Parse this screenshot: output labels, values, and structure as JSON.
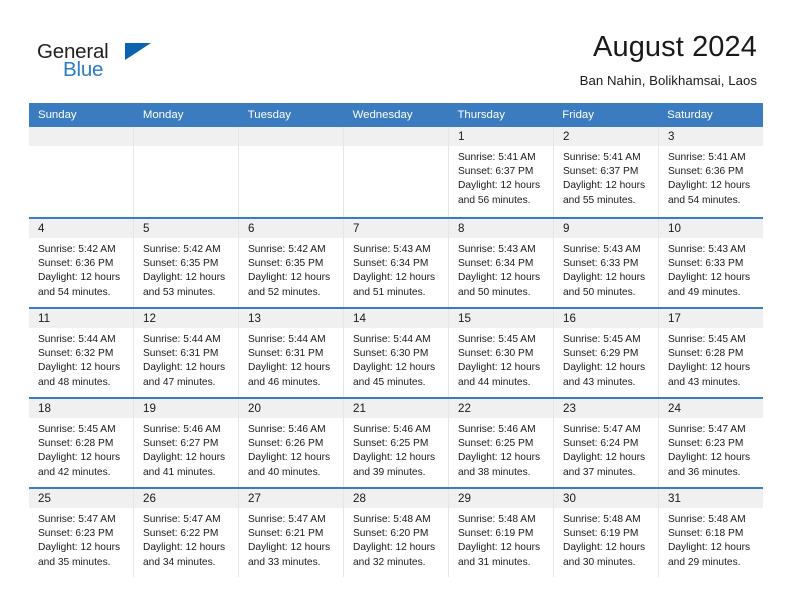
{
  "logo": {
    "word1": "General",
    "word2": "Blue",
    "flag_color": "#0b63ad"
  },
  "header": {
    "title": "August 2024",
    "subtitle": "Ban Nahin, Bolikhamsai, Laos"
  },
  "theme": {
    "header_band": "#3a7cbf",
    "daynum_band": "#f0f0f0",
    "cell_border": "#e6e6e6",
    "text": "#1a1a1a"
  },
  "weekdays": [
    "Sunday",
    "Monday",
    "Tuesday",
    "Wednesday",
    "Thursday",
    "Friday",
    "Saturday"
  ],
  "weeks": [
    [
      {
        "empty": true
      },
      {
        "empty": true
      },
      {
        "empty": true
      },
      {
        "empty": true
      },
      {
        "day": "1",
        "sunrise": "Sunrise: 5:41 AM",
        "sunset": "Sunset: 6:37 PM",
        "daylight1": "Daylight: 12 hours",
        "daylight2": "and 56 minutes."
      },
      {
        "day": "2",
        "sunrise": "Sunrise: 5:41 AM",
        "sunset": "Sunset: 6:37 PM",
        "daylight1": "Daylight: 12 hours",
        "daylight2": "and 55 minutes."
      },
      {
        "day": "3",
        "sunrise": "Sunrise: 5:41 AM",
        "sunset": "Sunset: 6:36 PM",
        "daylight1": "Daylight: 12 hours",
        "daylight2": "and 54 minutes."
      }
    ],
    [
      {
        "day": "4",
        "sunrise": "Sunrise: 5:42 AM",
        "sunset": "Sunset: 6:36 PM",
        "daylight1": "Daylight: 12 hours",
        "daylight2": "and 54 minutes."
      },
      {
        "day": "5",
        "sunrise": "Sunrise: 5:42 AM",
        "sunset": "Sunset: 6:35 PM",
        "daylight1": "Daylight: 12 hours",
        "daylight2": "and 53 minutes."
      },
      {
        "day": "6",
        "sunrise": "Sunrise: 5:42 AM",
        "sunset": "Sunset: 6:35 PM",
        "daylight1": "Daylight: 12 hours",
        "daylight2": "and 52 minutes."
      },
      {
        "day": "7",
        "sunrise": "Sunrise: 5:43 AM",
        "sunset": "Sunset: 6:34 PM",
        "daylight1": "Daylight: 12 hours",
        "daylight2": "and 51 minutes."
      },
      {
        "day": "8",
        "sunrise": "Sunrise: 5:43 AM",
        "sunset": "Sunset: 6:34 PM",
        "daylight1": "Daylight: 12 hours",
        "daylight2": "and 50 minutes."
      },
      {
        "day": "9",
        "sunrise": "Sunrise: 5:43 AM",
        "sunset": "Sunset: 6:33 PM",
        "daylight1": "Daylight: 12 hours",
        "daylight2": "and 50 minutes."
      },
      {
        "day": "10",
        "sunrise": "Sunrise: 5:43 AM",
        "sunset": "Sunset: 6:33 PM",
        "daylight1": "Daylight: 12 hours",
        "daylight2": "and 49 minutes."
      }
    ],
    [
      {
        "day": "11",
        "sunrise": "Sunrise: 5:44 AM",
        "sunset": "Sunset: 6:32 PM",
        "daylight1": "Daylight: 12 hours",
        "daylight2": "and 48 minutes."
      },
      {
        "day": "12",
        "sunrise": "Sunrise: 5:44 AM",
        "sunset": "Sunset: 6:31 PM",
        "daylight1": "Daylight: 12 hours",
        "daylight2": "and 47 minutes."
      },
      {
        "day": "13",
        "sunrise": "Sunrise: 5:44 AM",
        "sunset": "Sunset: 6:31 PM",
        "daylight1": "Daylight: 12 hours",
        "daylight2": "and 46 minutes."
      },
      {
        "day": "14",
        "sunrise": "Sunrise: 5:44 AM",
        "sunset": "Sunset: 6:30 PM",
        "daylight1": "Daylight: 12 hours",
        "daylight2": "and 45 minutes."
      },
      {
        "day": "15",
        "sunrise": "Sunrise: 5:45 AM",
        "sunset": "Sunset: 6:30 PM",
        "daylight1": "Daylight: 12 hours",
        "daylight2": "and 44 minutes."
      },
      {
        "day": "16",
        "sunrise": "Sunrise: 5:45 AM",
        "sunset": "Sunset: 6:29 PM",
        "daylight1": "Daylight: 12 hours",
        "daylight2": "and 43 minutes."
      },
      {
        "day": "17",
        "sunrise": "Sunrise: 5:45 AM",
        "sunset": "Sunset: 6:28 PM",
        "daylight1": "Daylight: 12 hours",
        "daylight2": "and 43 minutes."
      }
    ],
    [
      {
        "day": "18",
        "sunrise": "Sunrise: 5:45 AM",
        "sunset": "Sunset: 6:28 PM",
        "daylight1": "Daylight: 12 hours",
        "daylight2": "and 42 minutes."
      },
      {
        "day": "19",
        "sunrise": "Sunrise: 5:46 AM",
        "sunset": "Sunset: 6:27 PM",
        "daylight1": "Daylight: 12 hours",
        "daylight2": "and 41 minutes."
      },
      {
        "day": "20",
        "sunrise": "Sunrise: 5:46 AM",
        "sunset": "Sunset: 6:26 PM",
        "daylight1": "Daylight: 12 hours",
        "daylight2": "and 40 minutes."
      },
      {
        "day": "21",
        "sunrise": "Sunrise: 5:46 AM",
        "sunset": "Sunset: 6:25 PM",
        "daylight1": "Daylight: 12 hours",
        "daylight2": "and 39 minutes."
      },
      {
        "day": "22",
        "sunrise": "Sunrise: 5:46 AM",
        "sunset": "Sunset: 6:25 PM",
        "daylight1": "Daylight: 12 hours",
        "daylight2": "and 38 minutes."
      },
      {
        "day": "23",
        "sunrise": "Sunrise: 5:47 AM",
        "sunset": "Sunset: 6:24 PM",
        "daylight1": "Daylight: 12 hours",
        "daylight2": "and 37 minutes."
      },
      {
        "day": "24",
        "sunrise": "Sunrise: 5:47 AM",
        "sunset": "Sunset: 6:23 PM",
        "daylight1": "Daylight: 12 hours",
        "daylight2": "and 36 minutes."
      }
    ],
    [
      {
        "day": "25",
        "sunrise": "Sunrise: 5:47 AM",
        "sunset": "Sunset: 6:23 PM",
        "daylight1": "Daylight: 12 hours",
        "daylight2": "and 35 minutes."
      },
      {
        "day": "26",
        "sunrise": "Sunrise: 5:47 AM",
        "sunset": "Sunset: 6:22 PM",
        "daylight1": "Daylight: 12 hours",
        "daylight2": "and 34 minutes."
      },
      {
        "day": "27",
        "sunrise": "Sunrise: 5:47 AM",
        "sunset": "Sunset: 6:21 PM",
        "daylight1": "Daylight: 12 hours",
        "daylight2": "and 33 minutes."
      },
      {
        "day": "28",
        "sunrise": "Sunrise: 5:48 AM",
        "sunset": "Sunset: 6:20 PM",
        "daylight1": "Daylight: 12 hours",
        "daylight2": "and 32 minutes."
      },
      {
        "day": "29",
        "sunrise": "Sunrise: 5:48 AM",
        "sunset": "Sunset: 6:19 PM",
        "daylight1": "Daylight: 12 hours",
        "daylight2": "and 31 minutes."
      },
      {
        "day": "30",
        "sunrise": "Sunrise: 5:48 AM",
        "sunset": "Sunset: 6:19 PM",
        "daylight1": "Daylight: 12 hours",
        "daylight2": "and 30 minutes."
      },
      {
        "day": "31",
        "sunrise": "Sunrise: 5:48 AM",
        "sunset": "Sunset: 6:18 PM",
        "daylight1": "Daylight: 12 hours",
        "daylight2": "and 29 minutes."
      }
    ]
  ]
}
